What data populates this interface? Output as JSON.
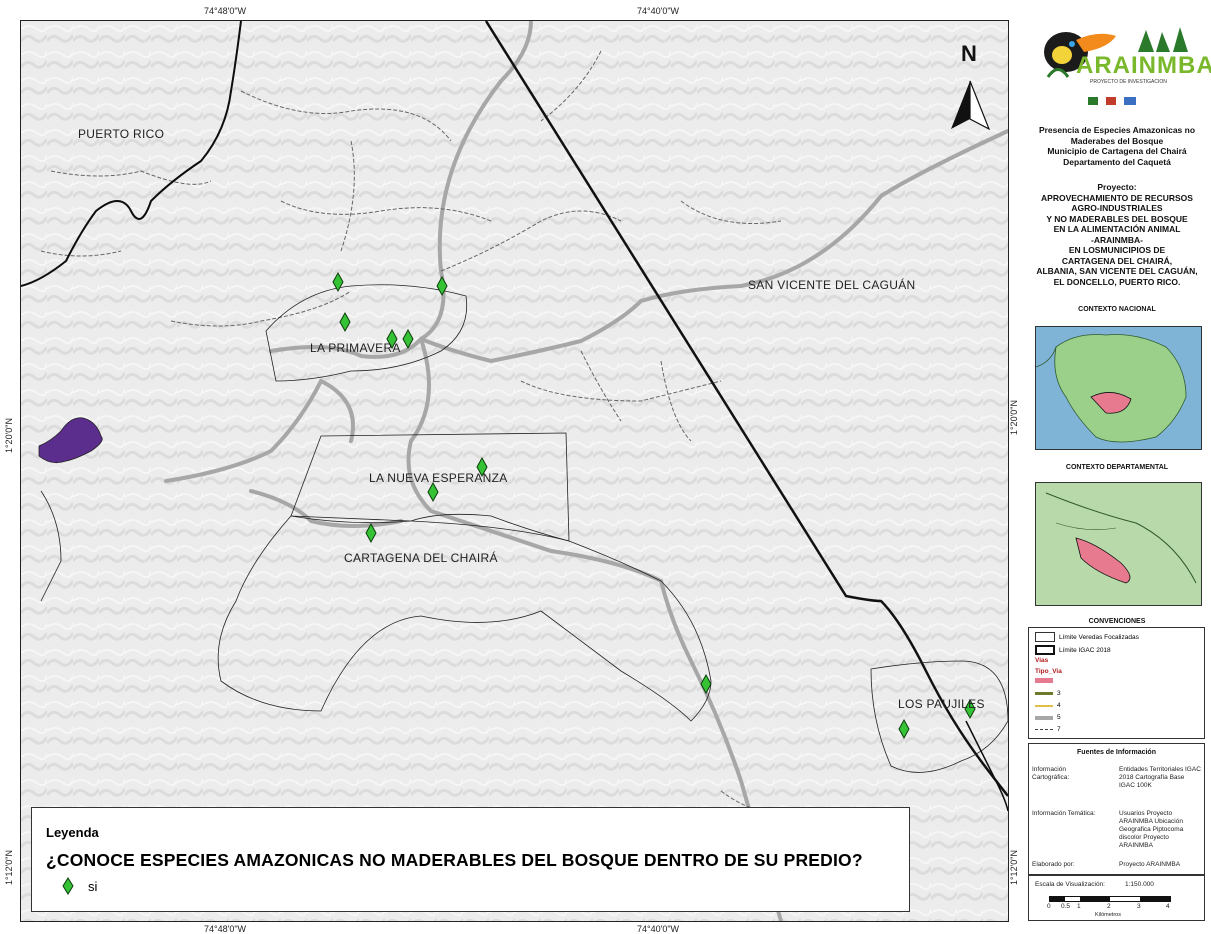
{
  "coordinates": {
    "top": [
      "74°48'0\"W",
      "74°40'0\"W"
    ],
    "bottom": [
      "74°48'0\"W",
      "74°40'0\"W"
    ],
    "left": [
      "1°20'0\"N",
      "1°12'0\"N"
    ],
    "right": [
      "1°20'0\"N",
      "1°12'0\"N"
    ]
  },
  "places": {
    "puerto_rico": "PUERTO RICO",
    "la_primavera": "LA PRIMAVERA",
    "san_vicente": "SAN VICENTE DEL CAGUÁN",
    "la_nueva_esperanza": "LA NUEVA ESPERANZA",
    "cartagena": "CARTAGENA DEL CHAIRÁ",
    "los_paujiles": "LOS PAUJILES"
  },
  "north_arrow": "N",
  "legend": {
    "title": "Leyenda",
    "question": "¿CONOCE ESPECIES AMAZONICAS NO MADERABLES DEL BOSQUE DENTRO DE SU PREDIO?",
    "item_label": "si",
    "item_color": "#35c235"
  },
  "logo": {
    "name": "ARAINMBA",
    "subtitle": "PROYECTO DE INVESTIGACION"
  },
  "map_title": {
    "line1": "Presencia de Especies Amazonicas no",
    "line2": "Maderabes del Bosque",
    "line3": "Municipio de Cartagena del Chairá",
    "line4": "Departamento del Caquetá"
  },
  "project": {
    "heading": "Proyecto:",
    "lines": [
      "APROVECHAMIENTO DE RECURSOS",
      "AGRO-INDUSTRIALES",
      "Y NO MADERABLES DEL BOSQUE",
      "EN LA ALIMENTACIÓN ANIMAL",
      "-ARAINMBA-",
      "EN LOSMUNICIPIOS DE",
      "CARTAGENA DEL CHAIRÁ,",
      "ALBANIA, SAN VICENTE DEL CAGUÁN,",
      "EL DONCELLO, PUERTO RICO."
    ]
  },
  "contexto_nacional": "CONTEXTO NACIONAL",
  "contexto_departamental": "CONTEXTO DEPARTAMENTAL",
  "convenciones": {
    "title": "CONVENCIONES",
    "items": [
      "Límite Veredas Focalizadas",
      "Límite IGAC 2018"
    ],
    "vias_title": "Vias",
    "tipo_via": "Tipo_Via",
    "via_types": [
      "3",
      "4",
      "5",
      "7"
    ]
  },
  "fuentes": {
    "title": "Fuentes de Información",
    "cartografica_label": "Información Cartográfica:",
    "cartografica_value": "Entidades Territoriales IGAC 2018 Cartografía Base IGAC 100K",
    "tematica_label": "Información Temática:",
    "tematica_value": "Usuarios Proyecto ARAINMBA Ubicación Geografica Piptocoma discolor Proyecto ARAINMBA",
    "elaborado_label": "Elaborado por:",
    "elaborado_value": "Proyecto ARAINMBA"
  },
  "escala": {
    "label": "Escala de Visualización:",
    "value": "1:150.000",
    "ticks": [
      "0",
      "0.5",
      "1",
      "2",
      "3",
      "4"
    ],
    "unit": "Kilómetros"
  },
  "colors": {
    "marker": "#35c235",
    "boundary": "#111111",
    "road": "#a7a7a7",
    "river": "#0d0d0d",
    "municipality_fill": "#5b2d8c",
    "highlight": "#e77a8f"
  }
}
